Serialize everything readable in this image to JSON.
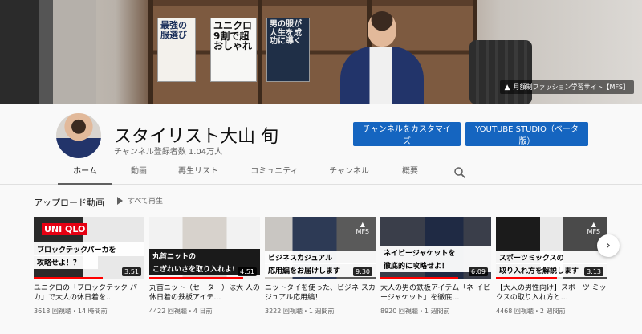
{
  "banner": {
    "tag_text": "月額制ファッション学習サイト【MFS】",
    "book1": "最強の服選び",
    "book2": "ユニクロ9割で超おしゃれ",
    "book3": "男の服が人生を成功に導く"
  },
  "channel": {
    "name": "スタイリスト大山 旬",
    "subscribers": "チャンネル登録者数 1.04万人",
    "customize_label": "チャンネルをカスタマイズ",
    "studio_label": "YOUTUBE STUDIO（ベータ版）"
  },
  "tabs": {
    "home": "ホーム",
    "videos": "動画",
    "playlists": "再生リスト",
    "community": "コミュニティ",
    "channels": "チャンネル",
    "about": "概要"
  },
  "uploads": {
    "title": "アップロード動画",
    "play_all": "すべて再生"
  },
  "videos": [
    {
      "overlay_top": "ブロックテックパーカを",
      "overlay_bottom": "攻略せよ！？",
      "duration": "3:51",
      "progress": 0.62,
      "title": "ユニクロの「ブロックテック パーカ」で大人の休日着を…",
      "meta": "3618 回視聴・14 時間前",
      "badge": "UNI QLO"
    },
    {
      "overlay_top": "丸首ニットの",
      "overlay_bottom": "こぎれいさを取り入れよ!",
      "duration": "4:51",
      "progress": 0.85,
      "title": "丸首ニット（セーター）は大 人の休日着の鉄板アイテ…",
      "meta": "4422 回視聴・4 日前"
    },
    {
      "overlay_top": "ビジネスカジュアル",
      "overlay_bottom": "応用編をお届けします",
      "duration": "9:30",
      "progress": 0.0,
      "title": "ニットタイを使った、ビジネ スカジュアル応用編！",
      "meta": "3222 回視聴・1 週間前",
      "mark": "MFS"
    },
    {
      "overlay_top": "ネイビージャケットを",
      "overlay_bottom": "徹底的に攻略せよ！",
      "duration": "6:09",
      "progress": 0.7,
      "title": "大人の男の鉄板アイテム「ネ イビージャケット」を徹底…",
      "meta": "8920 回視聴・1 週間前"
    },
    {
      "overlay_top": "スポーツミックスの",
      "overlay_bottom": "取り入れ方を解説します",
      "duration": "3:13",
      "progress": 0.55,
      "title": "【大人の男性向け】スポーツ ミックスの取り入れ方と…",
      "meta": "4468 回視聴・2 週間前",
      "mark": "MFS"
    }
  ],
  "colors": {
    "accent": "#1565c0",
    "progress": "#ff0000"
  }
}
